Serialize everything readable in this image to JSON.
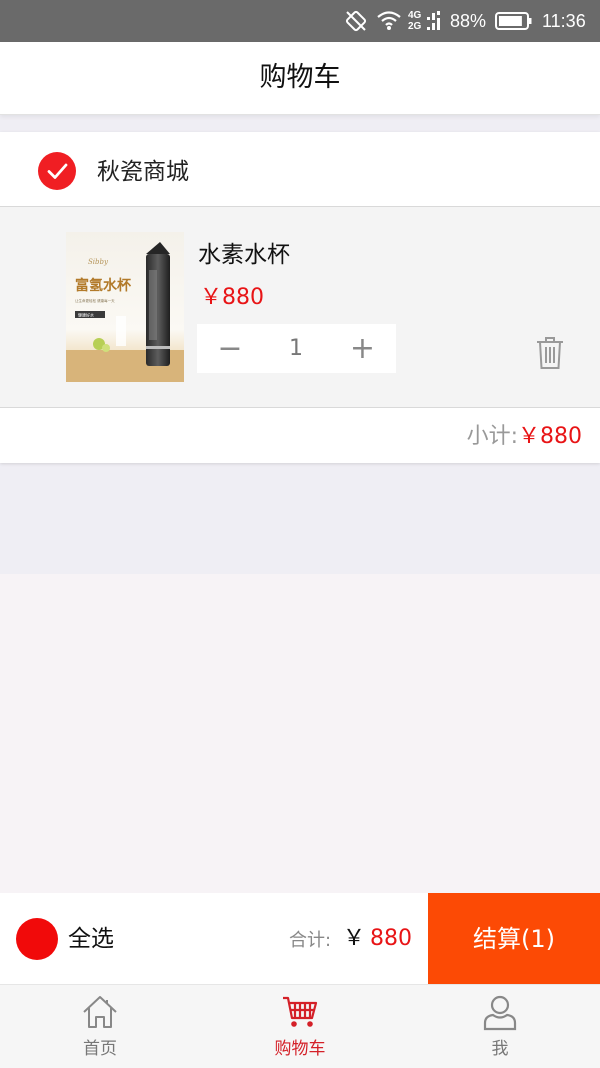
{
  "status_bar": {
    "network_top": "4G",
    "network_bottom": "2G",
    "battery_percent": "88%",
    "battery_level": 0.88,
    "time": "11:36",
    "icons": [
      "rotate-icon",
      "wifi-icon",
      "signal-icon",
      "battery-icon"
    ]
  },
  "header": {
    "title": "购物车"
  },
  "cart": {
    "shop": {
      "name": "秋瓷商城",
      "checked": true
    },
    "items": [
      {
        "name": "水素水杯",
        "price": "￥880",
        "quantity": "1",
        "minus_symbol": "−",
        "plus_symbol": "+",
        "thumb": {
          "headline": "富氢水杯",
          "script": "Sibby",
          "tagline": "让生命更轻松 健康每一天",
          "badge": "健康好水"
        }
      }
    ],
    "subtotal_label": "小计:",
    "subtotal_value": "￥880"
  },
  "bottom_bar": {
    "select_all_label": "全选",
    "total_label": "合计:",
    "total_currency": "￥",
    "total_value": "880",
    "checkout_label": "结算(1)"
  },
  "tabs": [
    {
      "label": "首页",
      "icon": "home-icon",
      "active": false
    },
    {
      "label": "购物车",
      "icon": "cart-icon",
      "active": true
    },
    {
      "label": "我",
      "icon": "user-icon",
      "active": false
    }
  ],
  "colors": {
    "accent": "#f01e23",
    "price": "#e81416",
    "checkout": "#fc4a05",
    "status_bar": "#6a6a6a",
    "tab_active": "#d42028"
  }
}
